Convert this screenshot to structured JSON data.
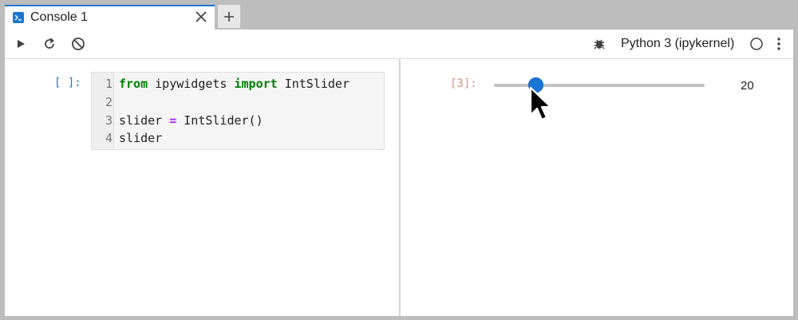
{
  "tab": {
    "title": "Console 1",
    "close_icon": "close-icon",
    "new_tab_icon": "plus-icon"
  },
  "toolbar": {
    "run_icon": "run-icon",
    "restart_icon": "restart-icon",
    "interrupt_icon": "stop-icon",
    "debugger_icon": "bug-icon",
    "kernel_name": "Python 3 (ipykernel)",
    "kernel_status_icon": "kernel-idle-icon",
    "more_icon": "more-vertical-icon"
  },
  "input_cell": {
    "prompt": "[ ]:",
    "lines": [
      {
        "number": "1",
        "text": "from ipywidgets import IntSlider"
      },
      {
        "number": "2",
        "text": ""
      },
      {
        "number": "3",
        "text": "slider = IntSlider()"
      },
      {
        "number": "4",
        "text": "slider"
      }
    ]
  },
  "output_cell": {
    "prompt": "[3]:",
    "slider": {
      "value": 20,
      "value_label": "20",
      "min": 0,
      "max": 100
    }
  },
  "colors": {
    "accent": "#1976d2",
    "keyword": "#008000",
    "operator": "#aa22ff",
    "out_prompt": "#e0917a"
  }
}
